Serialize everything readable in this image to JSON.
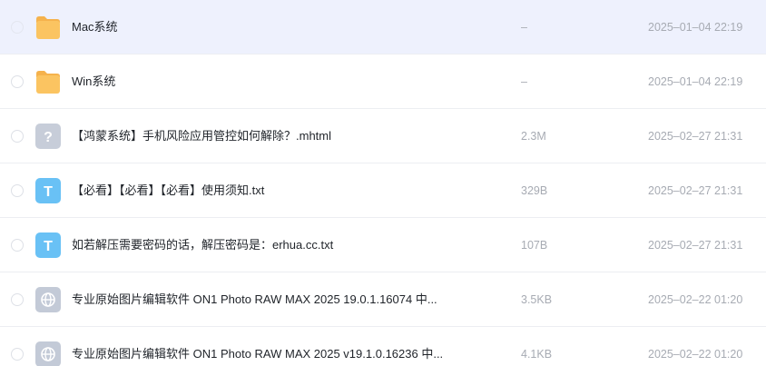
{
  "files": [
    {
      "name": "Mac系统",
      "size": "–",
      "date": "2025–01–04 22:19",
      "icon": "folder-icon",
      "selected": true
    },
    {
      "name": "Win系统",
      "size": "–",
      "date": "2025–01–04 22:19",
      "icon": "folder-icon",
      "selected": false
    },
    {
      "name": "【鸿蒙系统】手机风险应用管控如何解除？.mhtml",
      "size": "2.3M",
      "date": "2025–02–27 21:31",
      "icon": "unknown-file-icon",
      "glyph": "?",
      "selected": false
    },
    {
      "name": "【必看】【必看】【必看】使用须知.txt",
      "size": "329B",
      "date": "2025–02–27 21:31",
      "icon": "text-file-icon",
      "glyph": "T",
      "selected": false
    },
    {
      "name": "如若解压需要密码的话，解压密码是：erhua.cc.txt",
      "size": "107B",
      "date": "2025–02–27 21:31",
      "icon": "text-file-icon",
      "glyph": "T",
      "selected": false
    },
    {
      "name": "专业原始图片编辑软件 ON1 Photo RAW MAX 2025 19.0.1.16074 中...",
      "size": "3.5KB",
      "date": "2025–02–22 01:20",
      "icon": "web-link-icon",
      "selected": false
    },
    {
      "name": "专业原始图片编辑软件 ON1 Photo RAW MAX 2025 v19.1.0.16236 中...",
      "size": "4.1KB",
      "date": "2025–02–22 01:20",
      "icon": "web-link-icon",
      "selected": false
    }
  ],
  "colors": {
    "folder": "#fbc461",
    "folder_tab": "#f5b24c",
    "unknown": "#c7cdd9",
    "text_file": "#69c1f5",
    "web_link": "#c3cad7",
    "selected_row": "#eef1fd"
  }
}
